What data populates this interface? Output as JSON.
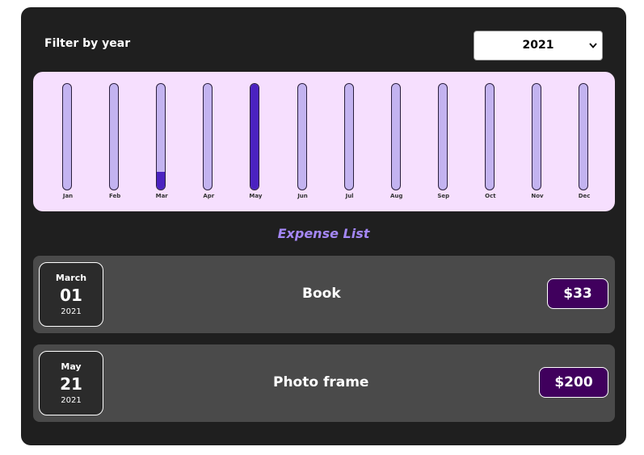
{
  "filter": {
    "label": "Filter by year",
    "selected_year": "2021"
  },
  "chart_data": {
    "type": "bar",
    "categories": [
      "Jan",
      "Feb",
      "Mar",
      "Apr",
      "May",
      "Jun",
      "Jul",
      "Aug",
      "Sep",
      "Oct",
      "Nov",
      "Dec"
    ],
    "values": [
      0,
      0,
      33,
      0,
      200,
      0,
      0,
      0,
      0,
      0,
      0,
      0
    ],
    "ylim": [
      0,
      200
    ],
    "fill_color": "#4b22c0",
    "track_color": "#c3b3f0"
  },
  "expense_list": {
    "title": "Expense List",
    "items": [
      {
        "month": "March",
        "day": "01",
        "year": "2021",
        "title": "Book",
        "amount": "$33"
      },
      {
        "month": "May",
        "day": "21",
        "year": "2021",
        "title": "Photo frame",
        "amount": "$200"
      }
    ]
  }
}
